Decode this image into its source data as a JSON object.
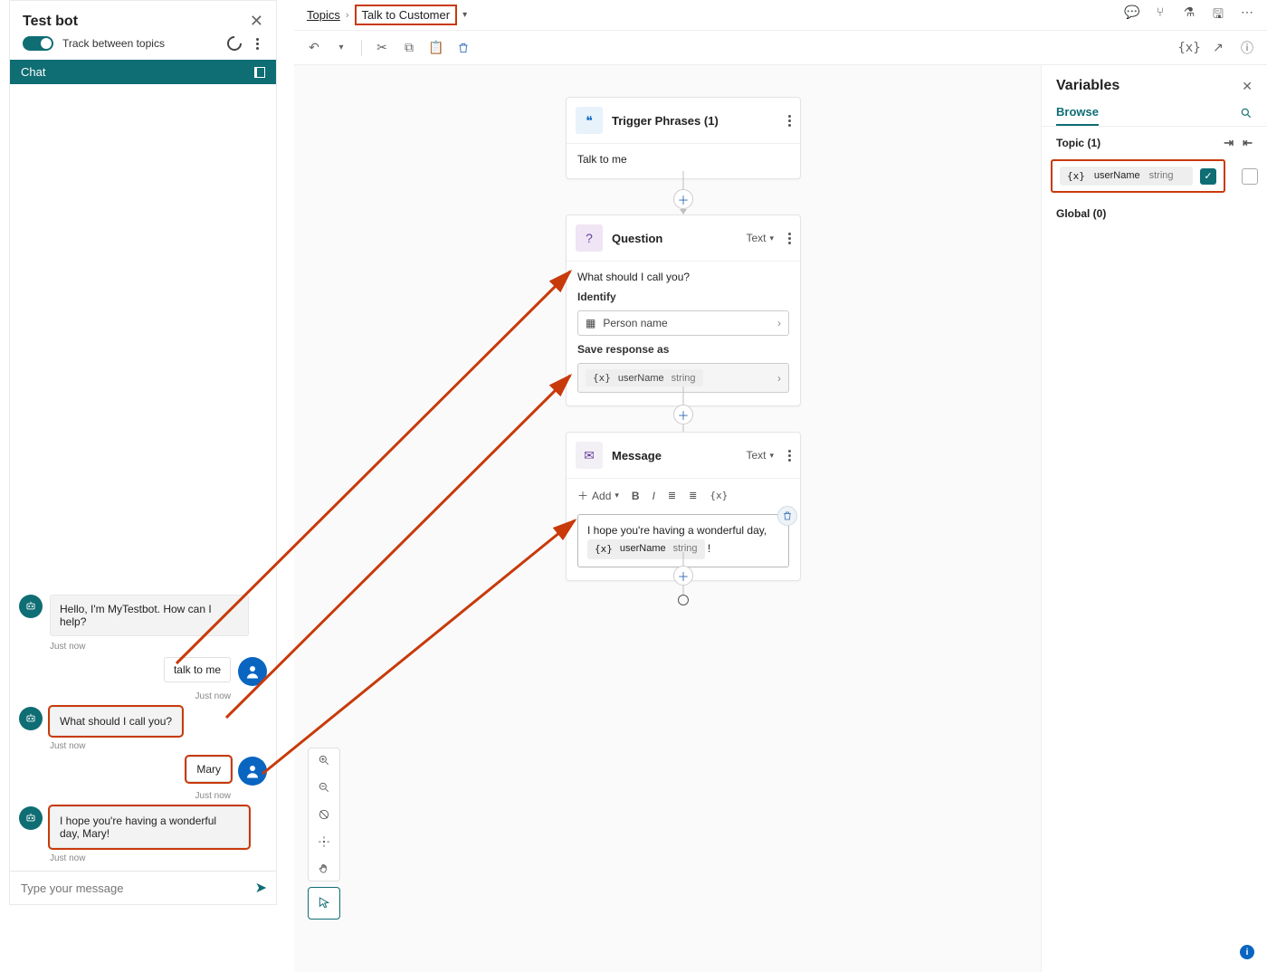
{
  "testPanel": {
    "title": "Test bot",
    "track": "Track between topics",
    "chatTab": "Chat",
    "messages": {
      "m1": "Hello, I'm MyTestbot. How can I help?",
      "m2": "talk to me",
      "m3": "What should I call you?",
      "m4": "Mary",
      "m5": "I hope you're having a wonderful day, Mary!",
      "ts": "Just now"
    },
    "inputPlaceholder": "Type your message"
  },
  "breadcrumb": {
    "root": "Topics",
    "current": "Talk to Customer"
  },
  "nodes": {
    "trigger": {
      "title": "Trigger Phrases (1)",
      "body": "Talk to me"
    },
    "question": {
      "title": "Question",
      "type": "Text",
      "prompt": "What should I call you?",
      "identifyLabel": "Identify",
      "identifyValue": "Person name",
      "saveLabel": "Save response as",
      "varName": "userName",
      "varType": "string",
      "varIcon": "{x}"
    },
    "message": {
      "title": "Message",
      "type": "Text",
      "addLabel": "Add",
      "text": "I hope you're having a wonderful day,",
      "suffix": "!",
      "varName": "userName",
      "varType": "string",
      "varIcon": "{x}"
    }
  },
  "variables": {
    "title": "Variables",
    "tab": "Browse",
    "topicLabel": "Topic (1)",
    "row": {
      "icon": "{x}",
      "name": "userName",
      "type": "string"
    },
    "globalLabel": "Global (0)"
  },
  "toolbar": {
    "varIcon": "{x}"
  }
}
